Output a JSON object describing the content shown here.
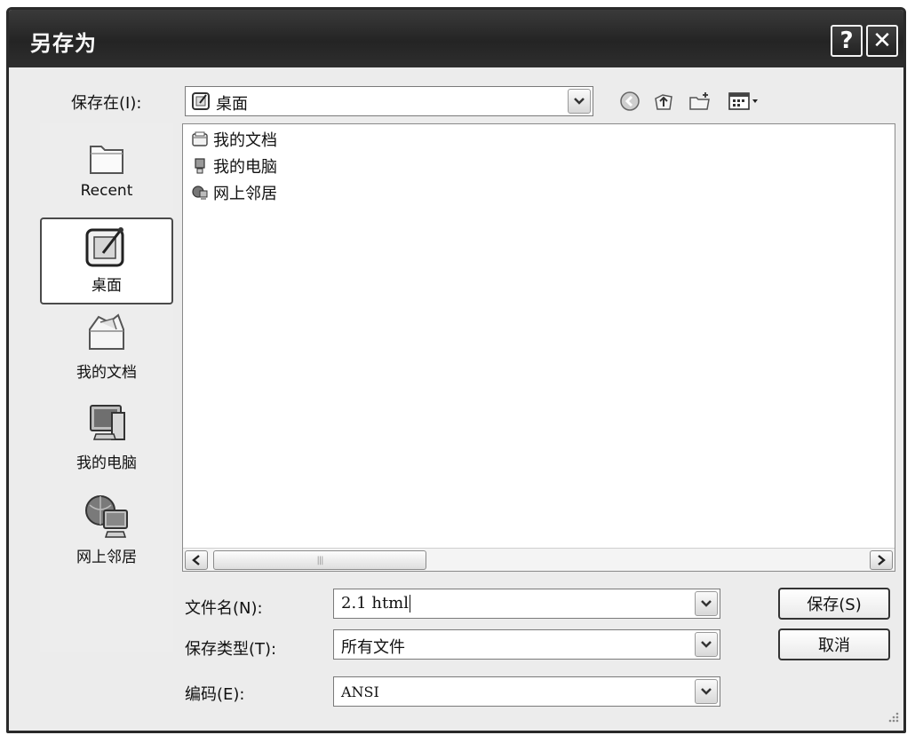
{
  "window": {
    "title": "另存为",
    "help_glyph": "?",
    "close_glyph": "✕"
  },
  "save_in": {
    "label": "保存在(I):",
    "value": "桌面"
  },
  "toolbar": {
    "icons": [
      "back-icon",
      "up-folder-icon",
      "new-folder-icon",
      "view-menu-icon"
    ]
  },
  "places": [
    {
      "label": "Recent",
      "icon": "recent-folder-icon"
    },
    {
      "label": "桌面",
      "icon": "desktop-icon",
      "active": true
    },
    {
      "label": "我的文档",
      "icon": "my-documents-icon"
    },
    {
      "label": "我的电脑",
      "icon": "my-computer-icon"
    },
    {
      "label": "网上邻居",
      "icon": "network-places-icon"
    }
  ],
  "files": [
    {
      "label": "我的文档",
      "icon": "my-documents-icon"
    },
    {
      "label": "我的电脑",
      "icon": "my-computer-icon"
    },
    {
      "label": "网上邻居",
      "icon": "network-places-icon"
    }
  ],
  "form": {
    "filename": {
      "label": "文件名(N):",
      "value": "2.1 html"
    },
    "filetype": {
      "label": "保存类型(T):",
      "value": "所有文件"
    },
    "encoding": {
      "label": "编码(E):",
      "value": "ANSI"
    }
  },
  "buttons": {
    "save": "保存(S)",
    "cancel": "取消"
  },
  "colors": {
    "titlebar": "#2a2a2a",
    "dialog_bg": "#ececec"
  }
}
